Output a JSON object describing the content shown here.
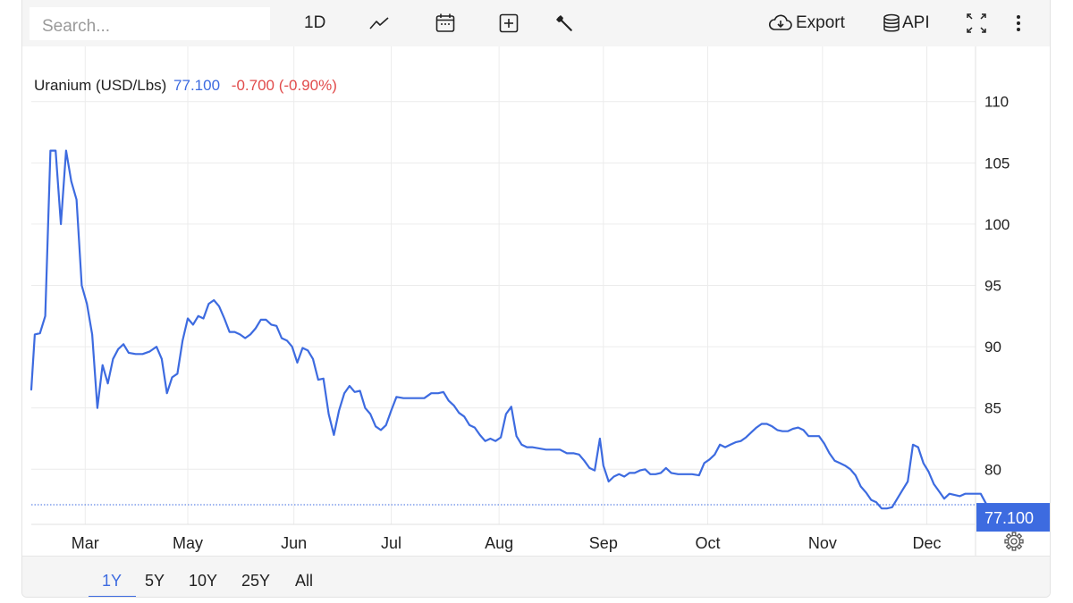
{
  "search": {
    "placeholder": "Search..."
  },
  "toolbar": {
    "interval_label": "1D",
    "export_label": "Export",
    "api_label": "API",
    "icons": [
      "line-chart-icon",
      "calendar-icon",
      "compare-add-icon",
      "wrench-icon",
      "cloud-download-icon",
      "database-icon",
      "fullscreen-icon",
      "more-vertical-icon"
    ]
  },
  "legend": {
    "name": "Uranium (USD/Lbs)",
    "price": "77.100",
    "change": "-0.700 (-0.90%)"
  },
  "colors": {
    "line": "#3d6be0",
    "negative": "#e14b4b",
    "last_price_tag": "#3d6be0",
    "grid": "#ececec"
  },
  "ranges": {
    "items": [
      "1Y",
      "5Y",
      "10Y",
      "25Y",
      "All"
    ],
    "active": "1Y"
  },
  "chart_data": {
    "type": "line",
    "title": "Uranium (USD/Lbs)",
    "xlabel": "",
    "ylabel": "",
    "x_tick_labels": [
      {
        "label": "Mar",
        "day": 31
      },
      {
        "label": "May",
        "day": 90
      },
      {
        "label": "Jun",
        "day": 151
      },
      {
        "label": "Jul",
        "day": 207
      },
      {
        "label": "Aug",
        "day": 269
      },
      {
        "label": "Sep",
        "day": 329
      },
      {
        "label": "Oct",
        "day": 389
      },
      {
        "label": "Nov",
        "day": 455
      },
      {
        "label": "Dec",
        "day": 515
      }
    ],
    "y_ticks": [
      80,
      85,
      90,
      95,
      100,
      105,
      110
    ],
    "ylim": [
      75.5,
      114.5
    ],
    "xlim": [
      0,
      543
    ],
    "last_price": 77.1,
    "grid": true,
    "series": [
      {
        "name": "Uranium (USD/Lbs)",
        "points": [
          [
            0,
            86.5
          ],
          [
            2,
            91
          ],
          [
            5,
            91.1
          ],
          [
            8,
            92.5
          ],
          [
            11,
            106
          ],
          [
            14,
            106
          ],
          [
            17,
            100
          ],
          [
            20,
            106
          ],
          [
            23,
            103.5
          ],
          [
            26,
            102
          ],
          [
            29,
            95
          ],
          [
            32,
            93.5
          ],
          [
            35,
            91
          ],
          [
            38,
            85
          ],
          [
            41,
            88.5
          ],
          [
            44,
            87
          ],
          [
            47,
            89
          ],
          [
            50,
            89.8
          ],
          [
            53,
            90.2
          ],
          [
            56,
            89.5
          ],
          [
            60,
            89.4
          ],
          [
            64,
            89.4
          ],
          [
            68,
            89.6
          ],
          [
            72,
            90
          ],
          [
            75,
            89
          ],
          [
            78,
            86.2
          ],
          [
            81,
            87.5
          ],
          [
            84,
            87.8
          ],
          [
            87,
            90.5
          ],
          [
            90,
            92.3
          ],
          [
            93,
            91.8
          ],
          [
            96,
            92.5
          ],
          [
            99,
            92.3
          ],
          [
            102,
            93.5
          ],
          [
            105,
            93.8
          ],
          [
            108,
            93.3
          ],
          [
            111,
            92.3
          ],
          [
            114,
            91.2
          ],
          [
            117,
            91.2
          ],
          [
            120,
            91
          ],
          [
            123,
            90.7
          ],
          [
            126,
            91
          ],
          [
            129,
            91.5
          ],
          [
            132,
            92.2
          ],
          [
            135,
            92.2
          ],
          [
            138,
            91.8
          ],
          [
            141,
            91.7
          ],
          [
            144,
            90.7
          ],
          [
            147,
            90.5
          ],
          [
            150,
            90
          ],
          [
            153,
            88.7
          ],
          [
            156,
            89.9
          ],
          [
            159,
            89.7
          ],
          [
            162,
            89
          ],
          [
            165,
            87.3
          ],
          [
            168,
            87.4
          ],
          [
            171,
            84.5
          ],
          [
            174,
            82.8
          ],
          [
            177,
            84.8
          ],
          [
            180,
            86.2
          ],
          [
            183,
            86.8
          ],
          [
            186,
            86.3
          ],
          [
            189,
            86.4
          ],
          [
            192,
            85
          ],
          [
            195,
            84.5
          ],
          [
            198,
            83.5
          ],
          [
            201,
            83.2
          ],
          [
            204,
            83.6
          ],
          [
            207,
            84.8
          ],
          [
            210,
            85.9
          ],
          [
            214,
            85.8
          ],
          [
            218,
            85.8
          ],
          [
            222,
            85.8
          ],
          [
            226,
            85.8
          ],
          [
            230,
            86.2
          ],
          [
            234,
            86.2
          ],
          [
            237,
            86.3
          ],
          [
            240,
            85.6
          ],
          [
            243,
            85.2
          ],
          [
            246,
            84.6
          ],
          [
            249,
            84.3
          ],
          [
            252,
            83.6
          ],
          [
            255,
            83.4
          ],
          [
            258,
            82.8
          ],
          [
            261,
            82.3
          ],
          [
            264,
            82.5
          ],
          [
            267,
            82.3
          ],
          [
            270,
            82.6
          ],
          [
            273,
            84.5
          ],
          [
            276,
            85.1
          ],
          [
            279,
            82.7
          ],
          [
            282,
            82
          ],
          [
            285,
            81.8
          ],
          [
            288,
            81.8
          ],
          [
            292,
            81.7
          ],
          [
            296,
            81.6
          ],
          [
            300,
            81.6
          ],
          [
            304,
            81.6
          ],
          [
            308,
            81.3
          ],
          [
            312,
            81.3
          ],
          [
            315,
            81.2
          ],
          [
            318,
            80.7
          ],
          [
            321,
            80.1
          ],
          [
            324,
            79.9
          ],
          [
            327,
            82.5
          ],
          [
            329,
            80.3
          ],
          [
            332,
            79
          ],
          [
            335,
            79.4
          ],
          [
            338,
            79.6
          ],
          [
            341,
            79.4
          ],
          [
            344,
            79.7
          ],
          [
            347,
            79.7
          ],
          [
            350,
            79.9
          ],
          [
            353,
            80
          ],
          [
            356,
            79.6
          ],
          [
            359,
            79.6
          ],
          [
            362,
            79.7
          ],
          [
            365,
            80.1
          ],
          [
            368,
            79.7
          ],
          [
            372,
            79.6
          ],
          [
            376,
            79.6
          ],
          [
            380,
            79.6
          ],
          [
            384,
            79.5
          ],
          [
            387,
            80.5
          ],
          [
            390,
            80.8
          ],
          [
            393,
            81.2
          ],
          [
            396,
            82
          ],
          [
            399,
            81.8
          ],
          [
            402,
            82
          ],
          [
            405,
            82.2
          ],
          [
            408,
            82.3
          ],
          [
            411,
            82.6
          ],
          [
            414,
            83
          ],
          [
            417,
            83.4
          ],
          [
            420,
            83.7
          ],
          [
            423,
            83.7
          ],
          [
            426,
            83.5
          ],
          [
            429,
            83.2
          ],
          [
            432,
            83.1
          ],
          [
            435,
            83.1
          ],
          [
            438,
            83.3
          ],
          [
            441,
            83.4
          ],
          [
            444,
            83.2
          ],
          [
            447,
            82.7
          ],
          [
            450,
            82.7
          ],
          [
            453,
            82.7
          ],
          [
            456,
            82.1
          ],
          [
            459,
            81.3
          ],
          [
            462,
            80.7
          ],
          [
            465,
            80.5
          ],
          [
            468,
            80.3
          ],
          [
            471,
            80
          ],
          [
            474,
            79.5
          ],
          [
            477,
            78.6
          ],
          [
            480,
            78.1
          ],
          [
            483,
            77.5
          ],
          [
            486,
            77.3
          ],
          [
            489,
            76.8
          ],
          [
            492,
            76.8
          ],
          [
            495,
            76.9
          ],
          [
            498,
            77.6
          ],
          [
            501,
            78.3
          ],
          [
            504,
            79
          ],
          [
            507,
            82
          ],
          [
            510,
            81.8
          ],
          [
            513,
            80.5
          ],
          [
            516,
            79.8
          ],
          [
            519,
            78.8
          ],
          [
            522,
            78.2
          ],
          [
            525,
            77.6
          ],
          [
            528,
            78
          ],
          [
            531,
            77.9
          ],
          [
            534,
            77.8
          ],
          [
            537,
            78
          ],
          [
            540,
            78
          ],
          [
            543,
            78
          ],
          [
            546,
            78
          ],
          [
            549,
            77.2
          ]
        ]
      }
    ]
  }
}
